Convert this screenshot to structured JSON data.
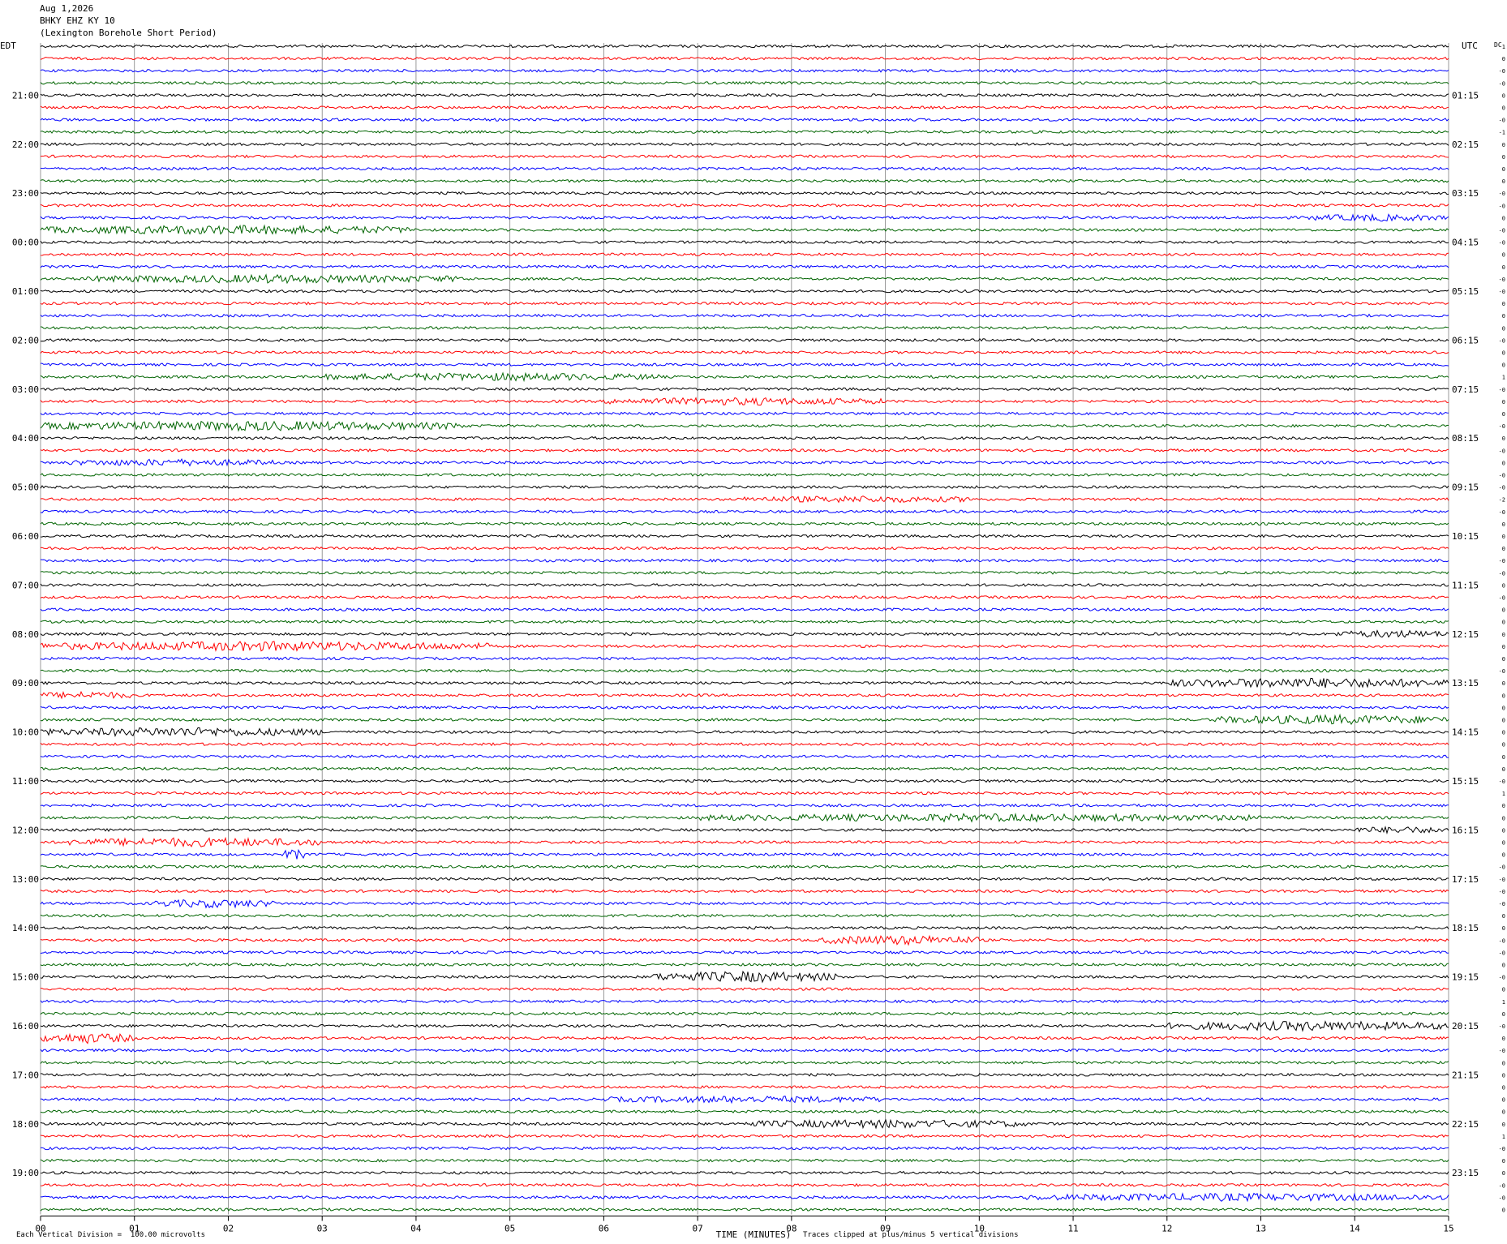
{
  "header": {
    "date": "Aug 1,2026",
    "station": "BHKY EHZ KY 10",
    "description": "(Lexington Borehole Short Period)"
  },
  "labels": {
    "left_tz": "EDT",
    "right_tz": "UTC",
    "dc": "DC"
  },
  "footer": {
    "scale": "Each Vertical Division =  100.00 microvolts",
    "clip": "Traces clipped at plus/minus 5 vertical divisions"
  },
  "colors": {
    "trace_cycle": [
      "#000000",
      "#ff0000",
      "#0000ff",
      "#006400"
    ],
    "grid": "#808080",
    "text": "#000000"
  },
  "chart_data": {
    "type": "line",
    "title": "",
    "xlabel": "TIME (MINUTES)",
    "x_ticks": [
      "00",
      "01",
      "02",
      "03",
      "04",
      "05",
      "06",
      "07",
      "08",
      "09",
      "10",
      "11",
      "12",
      "13",
      "14",
      "15"
    ],
    "xlim": [
      0,
      15
    ],
    "minutes_per_line": 15,
    "line_count": 96,
    "left_hour_labels": [
      "21:00",
      "22:00",
      "23:00",
      "00:00",
      "01:00",
      "02:00",
      "03:00",
      "04:00",
      "05:00",
      "06:00",
      "07:00",
      "08:00",
      "09:00",
      "10:00",
      "11:00",
      "12:00",
      "13:00",
      "14:00",
      "15:00",
      "16:00",
      "17:00",
      "18:00",
      "19:00"
    ],
    "right_hour_labels": [
      "01:15",
      "02:15",
      "03:15",
      "04:15",
      "05:15",
      "06:15",
      "07:15",
      "08:15",
      "09:15",
      "10:15",
      "11:15",
      "12:15",
      "13:15",
      "14:15",
      "15:15",
      "16:15",
      "17:15",
      "18:15",
      "19:15",
      "20:15",
      "21:15",
      "22:15",
      "23:15"
    ],
    "dc_offsets": [
      "1",
      "0",
      "-0",
      "-0",
      "0",
      "0",
      "-0",
      "-1",
      "0",
      "0",
      "0",
      "0",
      "-0",
      "-0",
      "0",
      "-0",
      "-0",
      "0",
      "0",
      "-0",
      "-0",
      "0",
      "0",
      "0",
      "-0",
      "0",
      "0",
      "1",
      "-0",
      "0",
      "0",
      "-0",
      "0",
      "-0",
      "0",
      "-0",
      "-0",
      "-2",
      "-0",
      "0",
      "0",
      "0",
      "-0",
      "-0",
      "0",
      "-0",
      "0",
      "0",
      "0",
      "0",
      "0",
      "-0",
      "0",
      "0",
      "0",
      "0",
      "0",
      "0",
      "0",
      "0",
      "-0",
      "1",
      "0",
      "0",
      "0",
      "0",
      "0",
      "-0",
      "-0",
      "-0",
      "-0",
      "0",
      "0",
      "-0",
      "-0",
      "0",
      "-0",
      "0",
      "1",
      "0",
      "-0",
      "0",
      "-0",
      "0",
      "0",
      "0",
      "0",
      "0",
      "0",
      "1",
      "-0",
      "0",
      "0",
      "-0",
      "-0",
      "0"
    ],
    "events": [
      {
        "line": 15,
        "start_min": 0.0,
        "end_min": 4.0,
        "amplitude": 2.2
      },
      {
        "line": 14,
        "start_min": 13.5,
        "end_min": 15.0,
        "amplitude": 1.5
      },
      {
        "line": 19,
        "start_min": 0.5,
        "end_min": 4.5,
        "amplitude": 2.0
      },
      {
        "line": 27,
        "start_min": 3.0,
        "end_min": 6.6,
        "amplitude": 1.8
      },
      {
        "line": 29,
        "start_min": 6.0,
        "end_min": 9.0,
        "amplitude": 1.7
      },
      {
        "line": 31,
        "start_min": 0.0,
        "end_min": 4.5,
        "amplitude": 2.4
      },
      {
        "line": 34,
        "start_min": 0.3,
        "end_min": 2.5,
        "amplitude": 1.5
      },
      {
        "line": 37,
        "start_min": 7.5,
        "end_min": 10.0,
        "amplitude": 1.4
      },
      {
        "line": 49,
        "start_min": 0.0,
        "end_min": 4.8,
        "amplitude": 2.4
      },
      {
        "line": 48,
        "start_min": 13.8,
        "end_min": 15.0,
        "amplitude": 1.7
      },
      {
        "line": 52,
        "start_min": 12.0,
        "end_min": 15.0,
        "amplitude": 2.6
      },
      {
        "line": 53,
        "start_min": 0.0,
        "end_min": 1.0,
        "amplitude": 1.6
      },
      {
        "line": 55,
        "start_min": 12.5,
        "end_min": 15.0,
        "amplitude": 2.3
      },
      {
        "line": 56,
        "start_min": 0.0,
        "end_min": 3.0,
        "amplitude": 2.2
      },
      {
        "line": 63,
        "start_min": 7.0,
        "end_min": 13.0,
        "amplitude": 1.8
      },
      {
        "line": 64,
        "start_min": 14.0,
        "end_min": 15.0,
        "amplitude": 1.5
      },
      {
        "line": 65,
        "start_min": 0.3,
        "end_min": 3.0,
        "amplitude": 2.2
      },
      {
        "line": 66,
        "start_min": 2.6,
        "end_min": 2.8,
        "amplitude": 3.0
      },
      {
        "line": 70,
        "start_min": 1.2,
        "end_min": 2.5,
        "amplitude": 2.0
      },
      {
        "line": 73,
        "start_min": 8.3,
        "end_min": 10.0,
        "amplitude": 2.4
      },
      {
        "line": 76,
        "start_min": 6.5,
        "end_min": 8.5,
        "amplitude": 2.8
      },
      {
        "line": 80,
        "start_min": 12.0,
        "end_min": 15.0,
        "amplitude": 2.4
      },
      {
        "line": 81,
        "start_min": 0.0,
        "end_min": 1.0,
        "amplitude": 2.6
      },
      {
        "line": 86,
        "start_min": 6.0,
        "end_min": 9.0,
        "amplitude": 1.5
      },
      {
        "line": 88,
        "start_min": 7.5,
        "end_min": 10.5,
        "amplitude": 2.0
      },
      {
        "line": 94,
        "start_min": 10.5,
        "end_min": 15.0,
        "amplitude": 1.8
      }
    ]
  }
}
